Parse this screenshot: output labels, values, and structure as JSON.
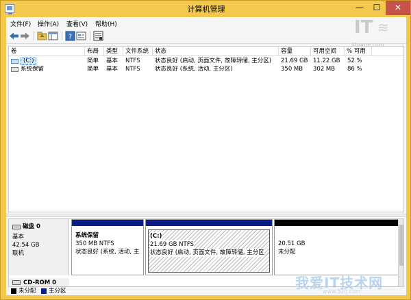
{
  "window": {
    "title": "计算机管理",
    "min_glyph": "—",
    "max_glyph": "☐",
    "close_glyph": "✕"
  },
  "menu": [
    "文件(F)",
    "操作(A)",
    "查看(V)",
    "帮助(H)"
  ],
  "toolbar_icons": [
    "back-arrow-icon",
    "forward-arrow-icon",
    "up-folder-icon",
    "show-hide-tree-icon",
    "help-icon",
    "properties-icon",
    "disk-manage-icon"
  ],
  "columns": [
    "卷",
    "布局",
    "类型",
    "文件系统",
    "状态",
    "容量",
    "可用空间",
    "% 可用"
  ],
  "volumes": [
    {
      "name": "(C:)",
      "layout": "简单",
      "type": "基本",
      "fs": "NTFS",
      "status": "状态良好 (启动, 页面文件, 故障转储, 主分区)",
      "capacity": "21.69 GB",
      "free": "11.22 GB",
      "pct": "52 %"
    },
    {
      "name": "系统保留",
      "layout": "简单",
      "type": "基本",
      "fs": "NTFS",
      "status": "状态良好 (系统, 活动, 主分区)",
      "capacity": "350 MB",
      "free": "302 MB",
      "pct": "86 %"
    }
  ],
  "disk0": {
    "name": "磁盘 0",
    "type": "基本",
    "size": "42.54 GB",
    "state": "联机",
    "partitions": [
      {
        "name": "系统保留",
        "size": "350 MB NTFS",
        "status": "状态良好 (系统, 活动, 主",
        "bar_color": "#0b1d86"
      },
      {
        "name": "(C:)",
        "size": "21.69 GB NTFS",
        "status": "状态良好 (启动, 页面文件, 故障转储, 主分区",
        "bar_color": "#0b1d86"
      },
      {
        "name": "",
        "size": "20.51 GB",
        "status": "未分配",
        "bar_color": "#000000"
      }
    ]
  },
  "cdrom": {
    "name": "CD-ROM 0"
  },
  "legend": [
    {
      "label": "未分配",
      "color": "#000000"
    },
    {
      "label": "主分区",
      "color": "#0b1d86"
    }
  ],
  "watermarks": {
    "it": "IT",
    "logo": "≋",
    "url": "ithome.com",
    "site": "我爱IT技术网",
    "site_url": "www.52ij.com"
  }
}
